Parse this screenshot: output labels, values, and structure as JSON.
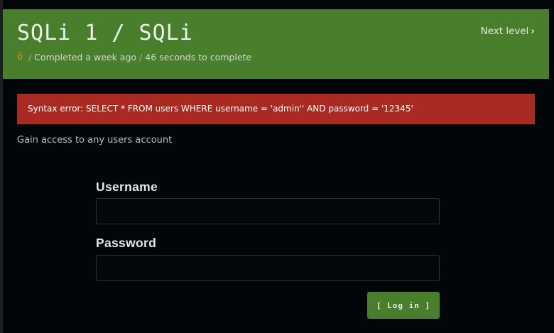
{
  "colors": {
    "header_bg": "#487e2c",
    "error_bg": "#a82a20",
    "page_bg": "#030608",
    "medal": "#f08a24"
  },
  "header": {
    "title": "SQLi 1 / SQLi",
    "medal_icon": "medal-icon",
    "medal_glyph": "ŏ",
    "separator": "/",
    "completed": "Completed a week ago",
    "duration": "46 seconds to complete",
    "next_level": "Next level",
    "next_icon": "chevron-right-icon",
    "next_glyph": "›"
  },
  "error": {
    "message": "Syntax error: SELECT * FROM users WHERE username = 'admin'' AND password = '12345'"
  },
  "description": "Gain access to any users account",
  "form": {
    "username_label": "Username",
    "username_value": "",
    "password_label": "Password",
    "password_value": "",
    "login_label": "[ Log in ]"
  }
}
